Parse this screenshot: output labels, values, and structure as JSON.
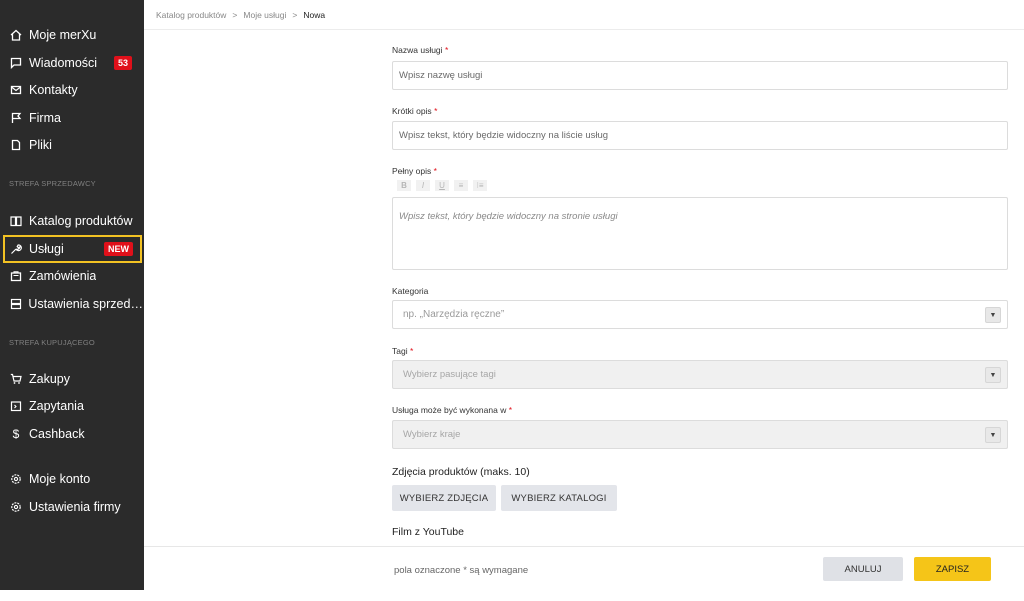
{
  "sidebar": {
    "items_top": [
      {
        "label": "Moje merXu",
        "icon": "home-icon"
      },
      {
        "label": "Wiadomości",
        "icon": "message-icon",
        "badge": "53"
      },
      {
        "label": "Kontakty",
        "icon": "contacts-icon"
      },
      {
        "label": "Firma",
        "icon": "flag-icon"
      },
      {
        "label": "Pliki",
        "icon": "file-icon"
      }
    ],
    "section_seller": "STREFA SPRZEDAWCY",
    "items_seller": [
      {
        "label": "Katalog produktów",
        "icon": "book-icon"
      },
      {
        "label": "Usługi",
        "icon": "wrench-icon",
        "badge": "NEW"
      },
      {
        "label": "Zamówienia",
        "icon": "bag-icon"
      },
      {
        "label": "Ustawienia sprzedaży",
        "icon": "settings-box-icon"
      }
    ],
    "section_buyer": "STREFA KUPUJĄCEGO",
    "items_buyer": [
      {
        "label": "Zakupy",
        "icon": "cart-icon"
      },
      {
        "label": "Zapytania",
        "icon": "inquiry-icon"
      },
      {
        "label": "Cashback",
        "icon": "dollar-icon"
      }
    ],
    "items_account": [
      {
        "label": "Moje konto",
        "icon": "gear-icon"
      },
      {
        "label": "Ustawienia firmy",
        "icon": "gear-icon"
      }
    ],
    "badge_color": "#e0101a",
    "highlight_color": "#f3c223"
  },
  "breadcrumb": {
    "items": [
      "Katalog produktów",
      "Moje usługi",
      "Nowa"
    ],
    "separator": ">"
  },
  "form": {
    "name": {
      "label": "Nazwa usługi",
      "required": "*",
      "placeholder": "Wpisz nazwę usługi"
    },
    "short_desc": {
      "label": "Krótki opis",
      "required": "*",
      "placeholder": "Wpisz tekst, który będzie widoczny na liście usług"
    },
    "full_desc": {
      "label": "Pełny opis",
      "required": "*",
      "placeholder": "Wpisz tekst, który będzie widoczny na stronie usługi",
      "toolbar": [
        "B",
        "I",
        "U",
        "≡",
        "⁝≡"
      ]
    },
    "category": {
      "label": "Kategoria",
      "placeholder": "np. „Narzędzia ręczne”"
    },
    "tags": {
      "label": "Tagi",
      "required": "*",
      "placeholder": "Wybierz pasujące tagi"
    },
    "countries": {
      "label": "Usługa może być wykonana w",
      "required": "*",
      "placeholder": "Wybierz kraje"
    },
    "photos": {
      "label": "Zdjęcia produktów (maks. 10)",
      "btn_photos": "WYBIERZ ZDJĘCIA",
      "btn_catalogs": "WYBIERZ KATALOGI"
    },
    "youtube": {
      "label": "Film z YouTube"
    }
  },
  "footer": {
    "note": "pola oznaczone * są wymagane",
    "cancel": "ANULUJ",
    "save": "ZAPISZ",
    "save_color": "#f5c518"
  }
}
